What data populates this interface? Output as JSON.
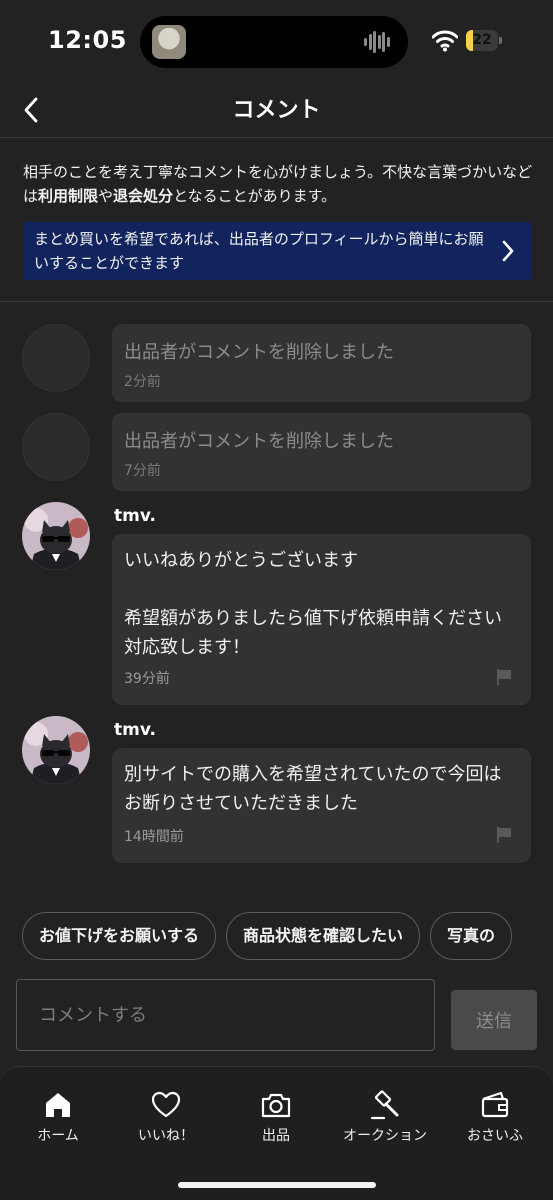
{
  "status_bar": {
    "time": "12:05",
    "battery": "22",
    "battery_level": 0.22
  },
  "header": {
    "title": "コメント"
  },
  "notice": {
    "text_1": "相手のことを考え丁寧なコメントを心がけましょう。不快な言葉づかいなどは",
    "bold_1": "利用制限",
    "text_2": "や",
    "bold_2": "退会処分",
    "text_3": "となることがあります。"
  },
  "banner": {
    "text": "まとめ買いを希望であれば、出品者のプロフィールから簡単にお願いすることができます"
  },
  "comments": [
    {
      "deleted": true,
      "text": "出品者がコメントを削除しました",
      "time": "2分前"
    },
    {
      "deleted": true,
      "text": "出品者がコメントを削除しました",
      "time": "7分前"
    },
    {
      "username": "tmv.",
      "text": "いいねありがとうございます\n\n希望額がありましたら値下げ依頼申請ください対応致します！",
      "time": "39分前"
    },
    {
      "username": "tmv.",
      "text": "別サイトでの購入を希望されていたので今回はお断りさせていただきました",
      "time": "14時間前"
    }
  ],
  "chips": [
    "お値下げをお願いする",
    "商品状態を確認したい",
    "写真の"
  ],
  "input": {
    "placeholder": "コメントする"
  },
  "send_button": "送信",
  "tabs": [
    {
      "label": "ホーム",
      "icon": "home-icon"
    },
    {
      "label": "いいね！",
      "icon": "heart-icon"
    },
    {
      "label": "出品",
      "icon": "camera-icon"
    },
    {
      "label": "オークション",
      "icon": "gavel-icon"
    },
    {
      "label": "おさいふ",
      "icon": "wallet-icon"
    }
  ],
  "colors": {
    "background": "#222222",
    "banner": "#11245e",
    "bubble": "#323232"
  }
}
